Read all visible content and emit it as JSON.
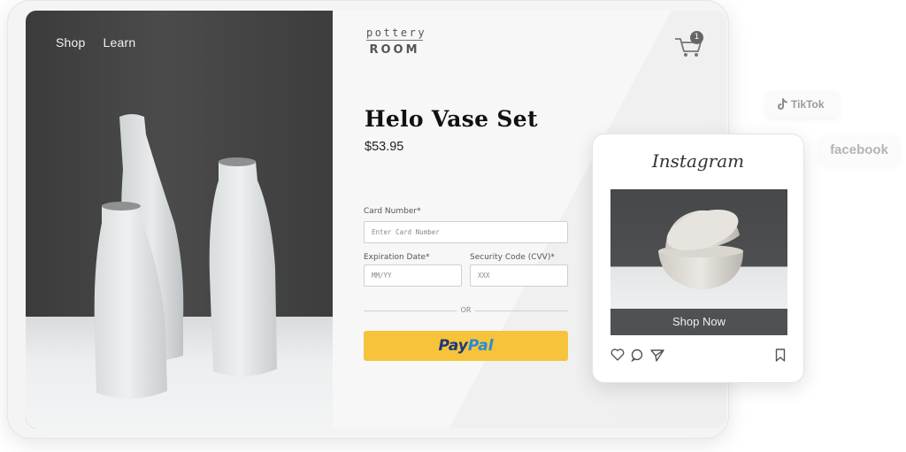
{
  "nav": {
    "shop": "Shop",
    "learn": "Learn"
  },
  "brand": {
    "top": "pottery",
    "bottom": "ROOM"
  },
  "cart": {
    "count": "1"
  },
  "product": {
    "title": "Helo Vase Set",
    "price": "$53.95"
  },
  "form": {
    "card_number_label": "Card Number*",
    "card_number_placeholder": "Enter Card Number",
    "expiration_label": "Expiration Date*",
    "expiration_placeholder": "MM/YY",
    "cvv_label": "Security Code (CVV)*",
    "cvv_placeholder": "XXX",
    "or_text": "OR",
    "paypal_pay": "Pay",
    "paypal_pal": "Pal"
  },
  "instagram": {
    "title": "Instagram",
    "cta": "Shop Now"
  },
  "social": {
    "tiktok": "TikTok",
    "facebook": "facebook"
  },
  "colors": {
    "paypal_yellow": "#f6c33a",
    "paypal_dark_blue": "#1d3a7a",
    "paypal_light_blue": "#2a8bd3",
    "shop_now_bg": "#4f5153"
  },
  "icons": [
    "cart-icon",
    "tiktok-icon",
    "heart-icon",
    "comment-icon",
    "send-icon",
    "bookmark-icon"
  ]
}
